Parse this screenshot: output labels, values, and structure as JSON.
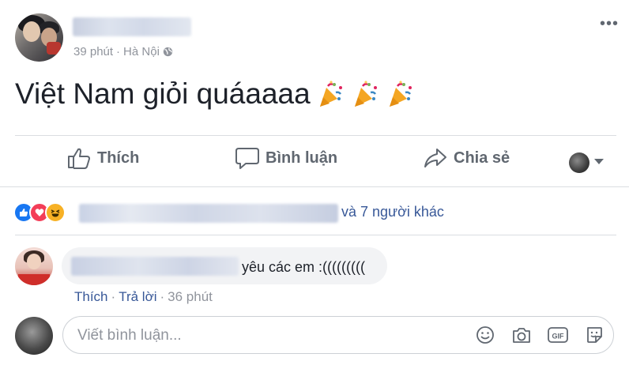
{
  "post": {
    "meta": {
      "time": "39 phút",
      "separator": "·",
      "location": "Hà Nội"
    },
    "text": "Việt Nam giỏi quáaaaa",
    "emoji_icons": [
      "party-popper-icon",
      "party-popper-icon",
      "party-popper-icon"
    ]
  },
  "actions": {
    "like": "Thích",
    "comment": "Bình luận",
    "share": "Chia sẻ"
  },
  "reactions": {
    "icons": [
      "like-icon",
      "love-icon",
      "haha-icon"
    ],
    "others": "và 7 người khác"
  },
  "comment": {
    "text": "yêu các em :(((((((((",
    "like": "Thích",
    "dot": "·",
    "reply": "Trả lời",
    "time": "36 phút"
  },
  "composer": {
    "placeholder": "Viết bình luận..."
  },
  "colors": {
    "link": "#385898",
    "muted": "#90949c",
    "action": "#606770",
    "bubble": "#f2f3f5",
    "like_blue": "#1877f2",
    "love_red": "#f33e58",
    "haha_yellow": "#f7b125"
  }
}
